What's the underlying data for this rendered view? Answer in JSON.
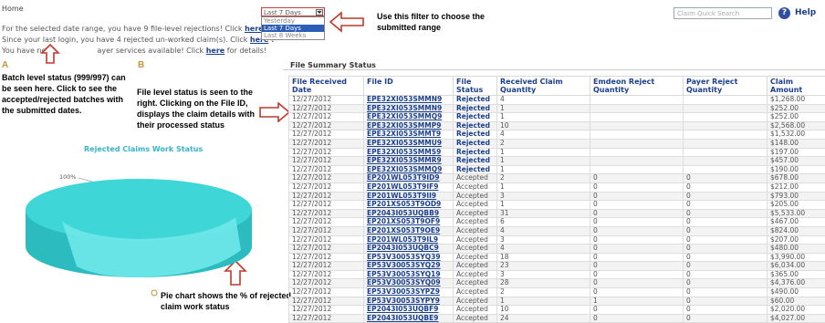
{
  "header": {
    "home": "Home",
    "search_placeholder": "Claim Quick Search",
    "help_icon": "?",
    "help_label": "Help"
  },
  "messages": [
    {
      "pre": "For the selected date range, you have 9 file-level rejections! Click ",
      "link": "here",
      "post": " f"
    },
    {
      "pre": "Since your last login, you have 4 rejected un-worked claim(s). Click ",
      "link": "here",
      "post": " t"
    },
    {
      "pre": "You have ne",
      "link": "",
      "post": "ayer services available! Click "
    },
    {
      "pre": "",
      "link": "here",
      "post": " for details!"
    }
  ],
  "filter": {
    "selected": "Last 7 Days",
    "options": [
      "Yesterday",
      "Last 7 Days",
      "Last 8 Weeks"
    ]
  },
  "callouts": {
    "filter": "Use this filter to choose the submitted range",
    "label_a": "A",
    "label_b": "B",
    "batch": "Batch level status (999/997) can be seen here. Click to see the accepted/rejected batches with the submitted dates.",
    "file": "File level status is seen to the right. Clicking on the File ID, displays the claim details with their processed status",
    "pie": "Pie chart shows the % of rejected claim work status"
  },
  "chart_data": {
    "type": "pie",
    "title": "Rejected Claims Work Status",
    "slices": [
      {
        "label": "100%",
        "value": 100,
        "color": "#3fd6d8"
      }
    ]
  },
  "file_summary": {
    "title": "File Summary Status",
    "columns": [
      "File Received Date",
      "File ID",
      "File Status",
      "Received Claim Quantity",
      "Emdeon Reject Quantity",
      "Payer Reject Quantity",
      "Claim Amount"
    ],
    "rows": [
      [
        "12/27/2012",
        "EPE32XI053SMMN9",
        "Rejected",
        "4",
        "",
        "",
        "$1,268.00"
      ],
      [
        "12/27/2012",
        "EPE32XI053SMMN9",
        "Rejected",
        "1",
        "",
        "",
        "$252.00"
      ],
      [
        "12/27/2012",
        "EPE32XI053SMMQ9",
        "Rejected",
        "1",
        "",
        "",
        "$252.00"
      ],
      [
        "12/27/2012",
        "EPE32XI053SMMP9",
        "Rejected",
        "10",
        "",
        "",
        "$2,568.00"
      ],
      [
        "12/27/2012",
        "EPE32XI053SMMT9",
        "Rejected",
        "4",
        "",
        "",
        "$1,532.00"
      ],
      [
        "12/27/2012",
        "EPE32XI053SMMU9",
        "Rejected",
        "2",
        "",
        "",
        "$148.00"
      ],
      [
        "12/27/2012",
        "EPE32XI053SMMS9",
        "Rejected",
        "1",
        "",
        "",
        "$197.00"
      ],
      [
        "12/27/2012",
        "EPE32XI053SMMR9",
        "Rejected",
        "1",
        "",
        "",
        "$457.00"
      ],
      [
        "12/27/2012",
        "EPE32XI053SMMQ9",
        "Rejected",
        "1",
        "",
        "",
        "$190.00"
      ],
      [
        "12/27/2012",
        "EP201WL053T9ID9",
        "Accepted",
        "2",
        "0",
        "0",
        "$678.00"
      ],
      [
        "12/27/2012",
        "EP201WL053T9IF9",
        "Accepted",
        "1",
        "0",
        "0",
        "$212.00"
      ],
      [
        "12/27/2012",
        "EP201WL053T9II9",
        "Accepted",
        "3",
        "0",
        "0",
        "$793.00"
      ],
      [
        "12/27/2012",
        "EP201XS053T9OD9",
        "Accepted",
        "1",
        "0",
        "0",
        "$205.00"
      ],
      [
        "12/27/2012",
        "EP2043I053UQBB9",
        "Accepted",
        "31",
        "0",
        "0",
        "$5,533.00"
      ],
      [
        "12/27/2012",
        "EP201XS053T9OF9",
        "Accepted",
        "6",
        "0",
        "0",
        "$467.00"
      ],
      [
        "12/27/2012",
        "EP201XS053T9OE9",
        "Accepted",
        "4",
        "0",
        "0",
        "$824.00"
      ],
      [
        "12/27/2012",
        "EP201WL053T9IL9",
        "Accepted",
        "3",
        "0",
        "0",
        "$207.00"
      ],
      [
        "12/27/2012",
        "EP2043I053UQBC9",
        "Accepted",
        "4",
        "0",
        "0",
        "$480.00"
      ],
      [
        "12/27/2012",
        "EP53V30053SYQ39",
        "Accepted",
        "18",
        "0",
        "0",
        "$3,990.00"
      ],
      [
        "12/27/2012",
        "EP53V30053SYQ29",
        "Accepted",
        "23",
        "0",
        "0",
        "$6,034.00"
      ],
      [
        "12/27/2012",
        "EP53V30053SYQ19",
        "Accepted",
        "3",
        "0",
        "0",
        "$365.00"
      ],
      [
        "12/27/2012",
        "EP53V30053SYQ09",
        "Accepted",
        "28",
        "0",
        "0",
        "$4,376.00"
      ],
      [
        "12/27/2012",
        "EP53V30053SYPZ9",
        "Accepted",
        "2",
        "0",
        "0",
        "$490.00"
      ],
      [
        "12/27/2012",
        "EP53V30053SYPY9",
        "Accepted",
        "1",
        "1",
        "0",
        "$60.00"
      ],
      [
        "12/27/2012",
        "EP2043I053UQBF9",
        "Accepted",
        "10",
        "0",
        "0",
        "$2,020.00"
      ],
      [
        "12/27/2012",
        "EP2043I053UQBE9",
        "Accepted",
        "24",
        "0",
        "0",
        "$4,027.00"
      ]
    ]
  },
  "colors": {
    "link": "#1a3f8f",
    "arrow": "#c0392b",
    "pie": "#3fd6d8",
    "pie_side": "#2cbcc0",
    "letters": "#c8943a"
  }
}
